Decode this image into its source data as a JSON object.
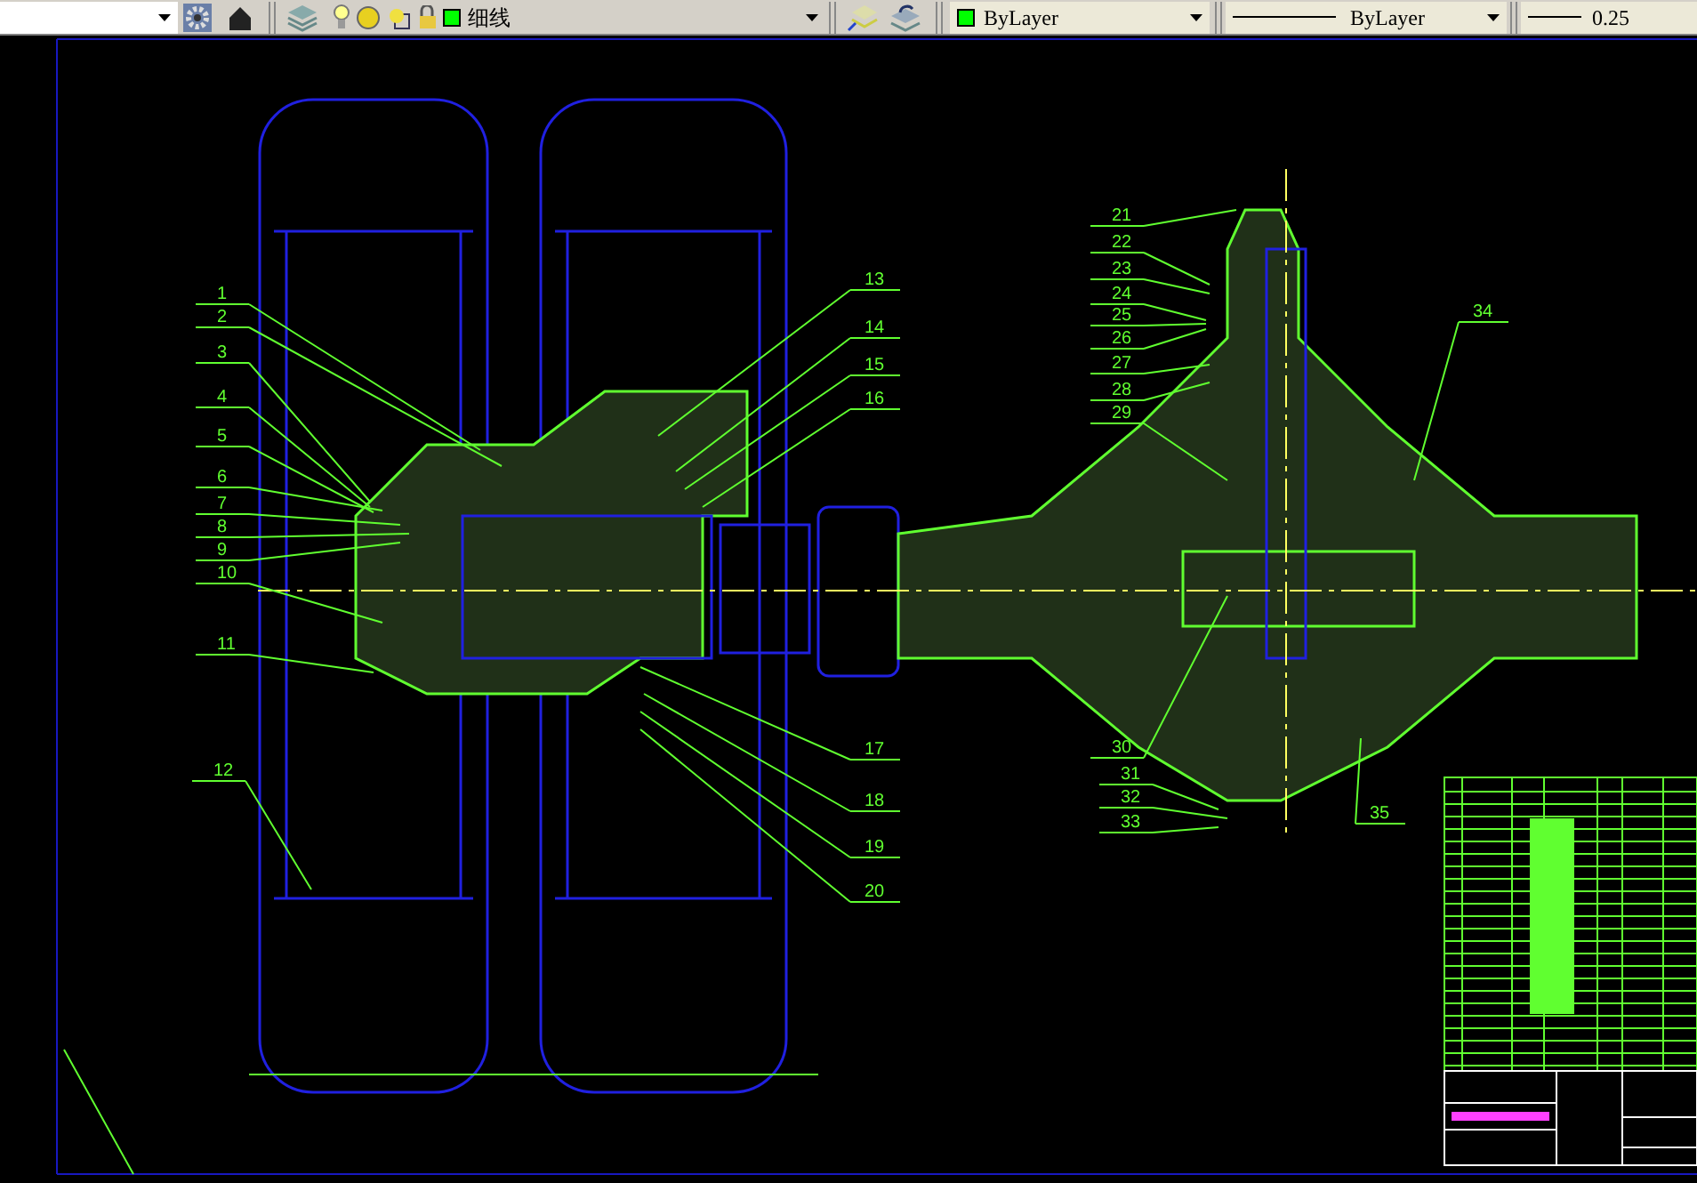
{
  "toolbar": {
    "layer_dropdown": {
      "value": "细线",
      "color": "#00ff00"
    },
    "color_dropdown": {
      "value": "ByLayer",
      "color": "#00ff00"
    },
    "linetype_dropdown": {
      "value": "ByLayer"
    },
    "lineweight_dropdown": {
      "value": "0.25"
    }
  },
  "drawing": {
    "part_labels": [
      "1",
      "2",
      "3",
      "4",
      "5",
      "6",
      "7",
      "8",
      "9",
      "10",
      "11",
      "12",
      "13",
      "14",
      "15",
      "16",
      "17",
      "18",
      "19",
      "20",
      "21",
      "22",
      "23",
      "24",
      "25",
      "26",
      "27",
      "28",
      "29",
      "30",
      "31",
      "32",
      "33",
      "34",
      "35"
    ]
  }
}
